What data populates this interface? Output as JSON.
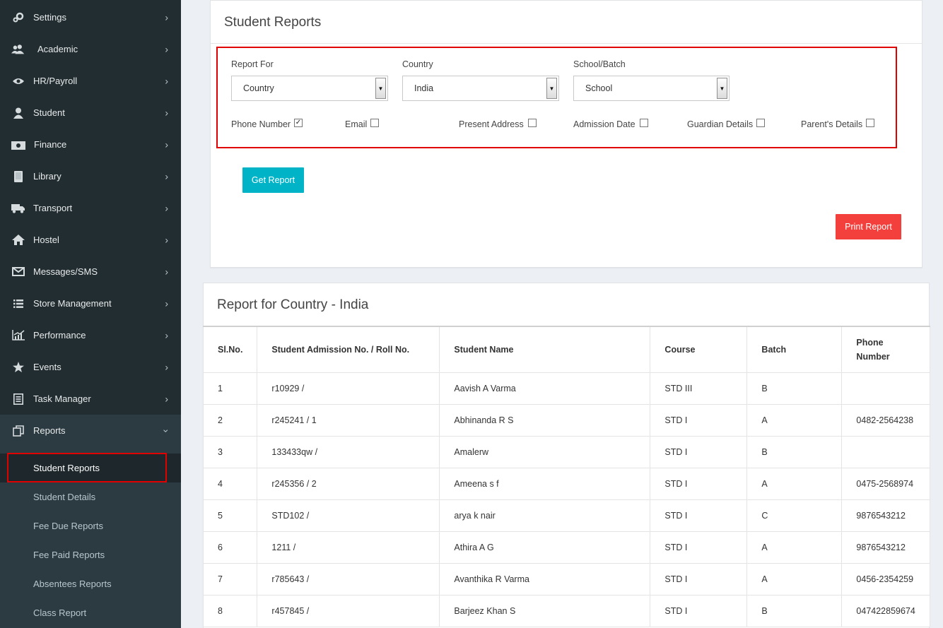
{
  "sidebar": {
    "items": [
      {
        "label": "Settings",
        "icon": "gears-icon"
      },
      {
        "label": "Academic",
        "icon": "users-icon"
      },
      {
        "label": "HR/Payroll",
        "icon": "eye-icon"
      },
      {
        "label": "Student",
        "icon": "user-icon"
      },
      {
        "label": "Finance",
        "icon": "money-icon"
      },
      {
        "label": "Library",
        "icon": "book-icon"
      },
      {
        "label": "Transport",
        "icon": "truck-icon"
      },
      {
        "label": "Hostel",
        "icon": "home-icon"
      },
      {
        "label": "Messages/SMS",
        "icon": "envelope-icon"
      },
      {
        "label": "Store Management",
        "icon": "list-icon"
      },
      {
        "label": "Performance",
        "icon": "chart-icon"
      },
      {
        "label": "Events",
        "icon": "star-icon"
      },
      {
        "label": "Task Manager",
        "icon": "task-icon"
      },
      {
        "label": "Reports",
        "icon": "copy-icon"
      }
    ],
    "reports_submenu": [
      "Student Reports",
      "Student Details",
      "Fee Due Reports",
      "Fee Paid Reports",
      "Absentees Reports",
      "Class Report"
    ]
  },
  "form_panel": {
    "title": "Student Reports",
    "report_for": {
      "label": "Report For",
      "value": "Country"
    },
    "country": {
      "label": "Country",
      "value": "India"
    },
    "school_batch": {
      "label": "School/Batch",
      "value": "School"
    },
    "checkboxes": [
      {
        "label": "Phone Number",
        "checked": true
      },
      {
        "label": "Email",
        "checked": false
      },
      {
        "label": "Present Address",
        "checked": false
      },
      {
        "label": "Admission Date",
        "checked": false
      },
      {
        "label": "Guardian Details",
        "checked": false
      },
      {
        "label": "Parent's Details",
        "checked": false
      }
    ],
    "get_report": "Get Report",
    "print_report": "Print Report",
    "colors": {
      "teal": "#00b3c7",
      "red": "#f3403c",
      "highlight": "#e00000"
    }
  },
  "report_panel": {
    "title": "Report for Country - India",
    "columns": [
      "Sl.No.",
      "Student Admission No. / Roll No.",
      "Student Name",
      "Course",
      "Batch",
      "Phone Number"
    ],
    "rows": [
      [
        "1",
        "r10929 /",
        "Aavish A Varma",
        "STD III",
        "B",
        ""
      ],
      [
        "2",
        "r245241 / 1",
        "Abhinanda R S",
        "STD I",
        "A",
        "0482-2564238"
      ],
      [
        "3",
        "133433qw /",
        "Amalerw",
        "STD I",
        "B",
        ""
      ],
      [
        "4",
        "r245356 / 2",
        "Ameena s f",
        "STD I",
        "A",
        "0475-2568974"
      ],
      [
        "5",
        "STD102 /",
        "arya k nair",
        "STD I",
        "C",
        "9876543212"
      ],
      [
        "6",
        "1211 /",
        "Athira A G",
        "STD I",
        "A",
        "9876543212"
      ],
      [
        "7",
        "r785643 /",
        "Avanthika R Varma",
        "STD I",
        "A",
        "0456-2354259"
      ],
      [
        "8",
        "r457845 /",
        "Barjeez Khan S",
        "STD I",
        "B",
        "047422859674"
      ]
    ]
  }
}
